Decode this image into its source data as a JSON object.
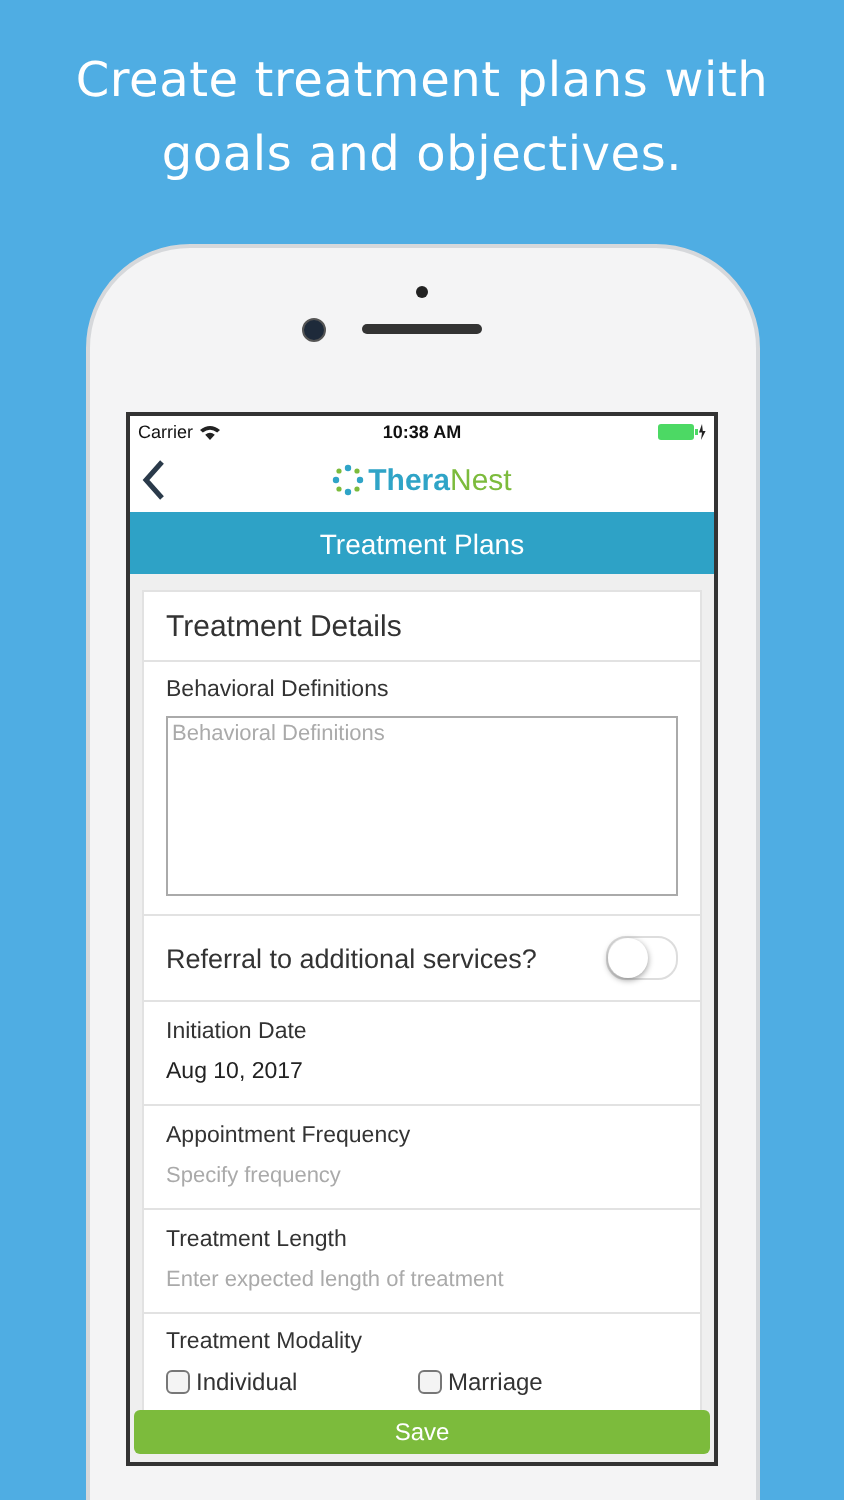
{
  "headline": "Create treatment plans with goals and objectives.",
  "status_bar": {
    "carrier": "Carrier",
    "time": "10:38 AM"
  },
  "nav": {
    "logo_first": "Thera",
    "logo_second": "Nest"
  },
  "title": "Treatment Plans",
  "card": {
    "heading": "Treatment Details",
    "fields": [
      {
        "kind": "textarea",
        "label": "Behavioral Definitions",
        "placeholder": "Behavioral Definitions"
      },
      {
        "kind": "toggle",
        "label": "Referral to additional services?",
        "on": false
      },
      {
        "kind": "value",
        "label": "Initiation Date",
        "value": "Aug 10, 2017"
      },
      {
        "kind": "input",
        "label": "Appointment Frequency",
        "placeholder": "Specify frequency"
      },
      {
        "kind": "input",
        "label": "Treatment Length",
        "placeholder": "Enter expected length of treatment"
      },
      {
        "kind": "checks",
        "label": "Treatment Modality",
        "options": [
          {
            "label": "Individual",
            "checked": false
          },
          {
            "label": "Marriage",
            "checked": false
          }
        ]
      }
    ]
  },
  "save": "Save"
}
